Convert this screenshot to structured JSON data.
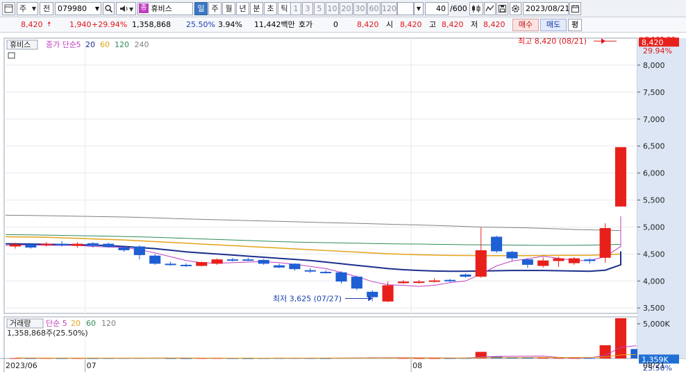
{
  "toolbar": {
    "market_type": "주",
    "history_label": "전",
    "code": "079980",
    "stock_badge": "종",
    "stock_name": "휴비스",
    "periods": [
      {
        "label": "일",
        "selected": true
      },
      {
        "label": "주",
        "selected": false
      },
      {
        "label": "월",
        "selected": false
      },
      {
        "label": "년",
        "selected": false
      },
      {
        "label": "분",
        "selected": false
      },
      {
        "label": "초",
        "selected": false
      },
      {
        "label": "틱",
        "selected": false
      }
    ],
    "intervals": [
      "1",
      "3",
      "5",
      "10",
      "20",
      "30",
      "60",
      "120"
    ],
    "count": "40",
    "count_total": "/600",
    "date": "2023/08/21"
  },
  "quote": {
    "price": "8,420",
    "change": "1,940",
    "change_pct": "+29.94%",
    "volume": "1,358,868",
    "turnover_pct": "25.50%",
    "pct2": "3.94%",
    "amount": "11,442백만",
    "hoga_label": "호가",
    "hoga_value": "0",
    "hoga_price": "8,420",
    "open_label": "시",
    "open": "8,420",
    "high_label": "고",
    "high": "8,420",
    "low_label": "저",
    "low": "8,420",
    "buy_label": "매수",
    "sell_label": "매도",
    "eval_label": "평"
  },
  "colors": {
    "up": "#e8201b",
    "down": "#1f5fd4",
    "ma5": "#c03cc0",
    "ma20": "#1c2f8c",
    "ma60": "#e3a317",
    "ma120": "#2e8b57",
    "ma240": "#808080"
  },
  "chart_data": [
    {
      "type": "candlestick",
      "legend_name": "휴비스",
      "legend_items": [
        {
          "label": "종가 단순",
          "color": "#c03cc0"
        },
        {
          "label": "5",
          "color": "#c03cc0"
        },
        {
          "label": "20",
          "color": "#1c2f8c"
        },
        {
          "label": "60",
          "color": "#e3a317"
        },
        {
          "label": "120",
          "color": "#2e8b57"
        },
        {
          "label": "240",
          "color": "#808080"
        }
      ],
      "ylim": [
        3400,
        8500
      ],
      "y_ticks": [
        3500,
        4000,
        4500,
        5000,
        5500,
        6000,
        6500,
        7000,
        7500,
        8000
      ],
      "y_tick_labels": [
        "3,500",
        "4,000",
        "4,500",
        "5,000",
        "5,500",
        "6,000",
        "6,500",
        "7,000",
        "7,500",
        "8,000"
      ],
      "top_right_label": "LC:132.28",
      "price_label": "8,420",
      "price_value": 8420,
      "pct_label": "29.94%",
      "high_annotation": "최고 8,420 (08/21)",
      "low_annotation": "최저 3,625 (07/27)",
      "candles": [
        {
          "date": "06/26",
          "o": 4640,
          "h": 4710,
          "l": 4600,
          "c": 4680
        },
        {
          "date": "06/27",
          "o": 4680,
          "h": 4700,
          "l": 4600,
          "c": 4620
        },
        {
          "date": "06/28",
          "o": 4670,
          "h": 4720,
          "l": 4640,
          "c": 4690
        },
        {
          "date": "06/29",
          "o": 4690,
          "h": 4740,
          "l": 4640,
          "c": 4660
        },
        {
          "date": "06/30",
          "o": 4650,
          "h": 4720,
          "l": 4620,
          "c": 4690
        },
        {
          "date": "07/03",
          "o": 4700,
          "h": 4720,
          "l": 4620,
          "c": 4650
        },
        {
          "date": "07/04",
          "o": 4690,
          "h": 4710,
          "l": 4620,
          "c": 4630
        },
        {
          "date": "07/05",
          "o": 4620,
          "h": 4640,
          "l": 4540,
          "c": 4570
        },
        {
          "date": "07/06",
          "o": 4640,
          "h": 4660,
          "l": 4400,
          "c": 4480
        },
        {
          "date": "07/07",
          "o": 4470,
          "h": 4500,
          "l": 4300,
          "c": 4320
        },
        {
          "date": "07/10",
          "o": 4320,
          "h": 4360,
          "l": 4280,
          "c": 4300
        },
        {
          "date": "07/11",
          "o": 4300,
          "h": 4330,
          "l": 4260,
          "c": 4280
        },
        {
          "date": "07/12",
          "o": 4280,
          "h": 4360,
          "l": 4270,
          "c": 4350
        },
        {
          "date": "07/13",
          "o": 4320,
          "h": 4420,
          "l": 4300,
          "c": 4400
        },
        {
          "date": "07/14",
          "o": 4400,
          "h": 4430,
          "l": 4360,
          "c": 4380
        },
        {
          "date": "07/17",
          "o": 4400,
          "h": 4430,
          "l": 4370,
          "c": 4380
        },
        {
          "date": "07/18",
          "o": 4390,
          "h": 4410,
          "l": 4300,
          "c": 4320
        },
        {
          "date": "07/19",
          "o": 4290,
          "h": 4320,
          "l": 4240,
          "c": 4250
        },
        {
          "date": "07/20",
          "o": 4320,
          "h": 4330,
          "l": 4190,
          "c": 4220
        },
        {
          "date": "07/21",
          "o": 4200,
          "h": 4240,
          "l": 4150,
          "c": 4180
        },
        {
          "date": "07/24",
          "o": 4170,
          "h": 4200,
          "l": 4140,
          "c": 4160
        },
        {
          "date": "07/25",
          "o": 4160,
          "h": 4180,
          "l": 3950,
          "c": 3990
        },
        {
          "date": "07/26",
          "o": 4080,
          "h": 4100,
          "l": 3830,
          "c": 3860
        },
        {
          "date": "07/27",
          "o": 3800,
          "h": 3830,
          "l": 3625,
          "c": 3700
        },
        {
          "date": "07/28",
          "o": 3620,
          "h": 3990,
          "l": 3610,
          "c": 3920
        },
        {
          "date": "07/31",
          "o": 3960,
          "h": 4020,
          "l": 3950,
          "c": 3990
        },
        {
          "date": "08/01",
          "o": 3980,
          "h": 4020,
          "l": 3950,
          "c": 3990
        },
        {
          "date": "08/02",
          "o": 3990,
          "h": 4050,
          "l": 3970,
          "c": 4010
        },
        {
          "date": "08/03",
          "o": 4020,
          "h": 4040,
          "l": 3980,
          "c": 4000
        },
        {
          "date": "08/04",
          "o": 4120,
          "h": 4140,
          "l": 4060,
          "c": 4080
        },
        {
          "date": "08/07",
          "o": 4080,
          "h": 4990,
          "l": 4060,
          "c": 4570
        },
        {
          "date": "08/08",
          "o": 4820,
          "h": 4840,
          "l": 4520,
          "c": 4550
        },
        {
          "date": "08/09",
          "o": 4540,
          "h": 4560,
          "l": 4380,
          "c": 4420
        },
        {
          "date": "08/10",
          "o": 4400,
          "h": 4420,
          "l": 4240,
          "c": 4300
        },
        {
          "date": "08/11",
          "o": 4280,
          "h": 4440,
          "l": 4250,
          "c": 4380
        },
        {
          "date": "08/14",
          "o": 4370,
          "h": 4450,
          "l": 4260,
          "c": 4420
        },
        {
          "date": "08/16",
          "o": 4330,
          "h": 4440,
          "l": 4300,
          "c": 4420
        },
        {
          "date": "08/17",
          "o": 4400,
          "h": 4420,
          "l": 4320,
          "c": 4370
        },
        {
          "date": "08/18",
          "o": 4430,
          "h": 5070,
          "l": 4340,
          "c": 4980
        },
        {
          "date": "08/21",
          "o": 5380,
          "h": 6480,
          "l": 5380,
          "c": 6480
        }
      ],
      "ma5": [
        4660,
        4670,
        4660,
        4660,
        4660,
        4640,
        4630,
        4620,
        4580,
        4520,
        4450,
        4380,
        4340,
        4330,
        4340,
        4350,
        4360,
        4340,
        4310,
        4270,
        4230,
        4160,
        4080,
        3990,
        3930,
        3920,
        3900,
        3920,
        3970,
        4000,
        4130,
        4280,
        4370,
        4410,
        4460,
        4420,
        4380,
        4380,
        4450,
        4640,
        5200
      ],
      "ma20": [
        4690,
        4685,
        4680,
        4675,
        4670,
        4665,
        4655,
        4640,
        4620,
        4600,
        4570,
        4540,
        4520,
        4500,
        4480,
        4460,
        4440,
        4420,
        4400,
        4380,
        4350,
        4320,
        4290,
        4260,
        4230,
        4210,
        4195,
        4185,
        4180,
        4180,
        4185,
        4190,
        4195,
        4195,
        4195,
        4190,
        4185,
        4180,
        4200,
        4300,
        4550
      ],
      "ma60": [
        4820,
        4815,
        4810,
        4800,
        4790,
        4780,
        4770,
        4760,
        4745,
        4730,
        4715,
        4700,
        4685,
        4670,
        4655,
        4640,
        4625,
        4610,
        4595,
        4580,
        4565,
        4550,
        4535,
        4520,
        4505,
        4495,
        4485,
        4480,
        4475,
        4472,
        4470,
        4470,
        4470,
        4470,
        4472,
        4474,
        4476,
        4478,
        4485,
        4500,
        4540
      ],
      "ma120": [
        4860,
        4855,
        4850,
        4845,
        4840,
        4835,
        4830,
        4825,
        4818,
        4810,
        4800,
        4790,
        4780,
        4770,
        4760,
        4750,
        4740,
        4730,
        4722,
        4715,
        4710,
        4705,
        4700,
        4695,
        4690,
        4687,
        4684,
        4680,
        4676,
        4672,
        4670,
        4668,
        4665,
        4663,
        4660,
        4660,
        4662,
        4665,
        4670,
        4680,
        4700
      ],
      "ma240": [
        5220,
        5215,
        5210,
        5205,
        5200,
        5195,
        5190,
        5185,
        5180,
        5170,
        5160,
        5150,
        5142,
        5135,
        5128,
        5120,
        5112,
        5105,
        5098,
        5090,
        5082,
        5075,
        5068,
        5060,
        5052,
        5045,
        5038,
        5030,
        5020,
        5010,
        5000,
        4995,
        4990,
        4985,
        4975,
        4965,
        4955,
        4948,
        4940,
        4935,
        4930
      ],
      "x_labels": [
        {
          "label": "2023/06",
          "index": 0
        },
        {
          "label": "07",
          "index": 5
        },
        {
          "label": "08",
          "index": 26
        }
      ],
      "last_date_label": "08/21"
    },
    {
      "type": "bar",
      "title": "거래량",
      "legend_items": [
        {
          "label": "단순 5",
          "color": "#c03cc0"
        },
        {
          "label": "20",
          "color": "#e3a317"
        },
        {
          "label": "60",
          "color": "#2e8b57"
        },
        {
          "label": "120",
          "color": "#808080"
        }
      ],
      "info_label": "1,358,868주(25.50%)",
      "ylim": [
        0,
        5400000
      ],
      "y_tick_value": 5000000,
      "y_tick_label": "5,000K",
      "current_label": "1,359K",
      "current_value": 1358868,
      "pct_label": "25.50%",
      "values": [
        50000,
        40000,
        60000,
        40000,
        50000,
        40000,
        50000,
        70000,
        80000,
        90000,
        40000,
        30000,
        50000,
        60000,
        40000,
        30000,
        50000,
        60000,
        70000,
        50000,
        40000,
        90000,
        110000,
        150000,
        140000,
        60000,
        40000,
        40000,
        40000,
        60000,
        950000,
        300000,
        160000,
        150000,
        90000,
        80000,
        70000,
        60000,
        1900000,
        5800000,
        1358868
      ],
      "up": [
        true,
        false,
        true,
        false,
        true,
        false,
        false,
        false,
        false,
        false,
        false,
        false,
        true,
        true,
        false,
        false,
        false,
        false,
        false,
        false,
        false,
        false,
        false,
        false,
        true,
        true,
        true,
        true,
        false,
        false,
        true,
        false,
        false,
        false,
        true,
        true,
        true,
        false,
        true,
        true,
        false
      ],
      "ma5": [
        60000,
        55000,
        52000,
        50000,
        48000,
        46000,
        46000,
        50000,
        56000,
        62000,
        64000,
        60000,
        56000,
        54000,
        48000,
        46000,
        46000,
        48000,
        52000,
        54000,
        54000,
        60000,
        72000,
        92000,
        104000,
        108000,
        100000,
        88000,
        66000,
        48000,
        226000,
        288000,
        310000,
        324000,
        332000,
        156000,
        110000,
        90000,
        440000,
        1600000,
        1840000
      ],
      "ma20": [
        70000,
        69000,
        68000,
        67000,
        66000,
        65000,
        64000,
        63000,
        62000,
        61000,
        60000,
        59000,
        58000,
        57000,
        56000,
        56000,
        56000,
        57000,
        58000,
        59000,
        60000,
        62000,
        64000,
        66000,
        68000,
        70000,
        71000,
        71000,
        70000,
        69000,
        110000,
        124000,
        130000,
        134000,
        136000,
        136000,
        136000,
        136000,
        224000,
        510000,
        560000
      ]
    }
  ]
}
